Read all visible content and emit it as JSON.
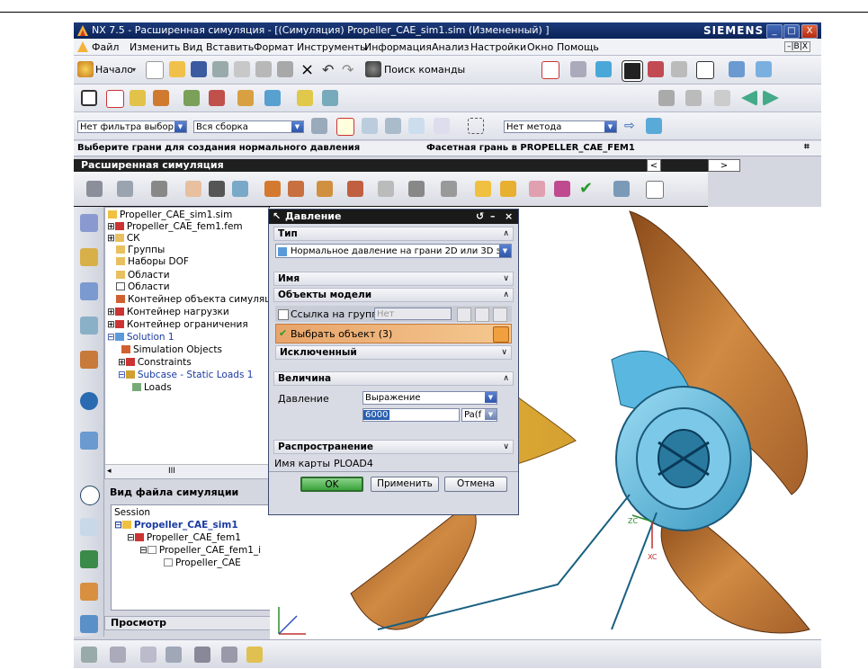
{
  "window": {
    "title": "NX 7.5 - Расширенная симуляция - [(Симуляция) Propeller_CAE_sim1.sim (Измененный) ]",
    "brand": "SIEMENS",
    "controls": [
      "_",
      "□",
      "X"
    ]
  },
  "menu": {
    "items": [
      "Файл",
      "Изменить",
      "Вид",
      "Вставить",
      "Формат",
      "Инструменты",
      "Информация",
      "Анализ",
      "Настройки",
      "Окно",
      "Помощь"
    ],
    "right": "–|B|X"
  },
  "toolbar1": {
    "start_label": "Начало",
    "find_command": "Поиск команды"
  },
  "selection_bar": {
    "filter": "Нет фильтра выбор",
    "scope": "Вся сборка",
    "method": "Нет метода"
  },
  "cue": {
    "left": "Выберите грани для создания нормального давления",
    "right": "Фасетная грань в PROPELLER_CAE_FEM1"
  },
  "adv_sim": {
    "title": "Расширенная симуляция",
    "nav_left": "<",
    "nav_right": ">"
  },
  "nav_tree": {
    "items": [
      {
        "label": "Propeller_CAE_sim1.sim",
        "prefix": ""
      },
      {
        "label": "Propeller_CAE_fem1.fem",
        "prefix": "⊞"
      },
      {
        "label": "СК",
        "prefix": "⊞"
      },
      {
        "label": "Группы",
        "prefix": ""
      },
      {
        "label": "Наборы DOF",
        "prefix": ""
      },
      {
        "label": "Области",
        "prefix": ""
      },
      {
        "label": "Области",
        "prefix": ""
      },
      {
        "label": "Контейнер объекта симуляции",
        "prefix": ""
      },
      {
        "label": "Контейнер нагрузки",
        "prefix": "⊞"
      },
      {
        "label": "Контейнер ограничения",
        "prefix": "⊞"
      },
      {
        "label": "Solution 1",
        "prefix": "⊟"
      },
      {
        "label": "Simulation Objects",
        "prefix": ""
      },
      {
        "label": "Constraints",
        "prefix": "⊞"
      },
      {
        "label": "Subcase - Static Loads 1",
        "prefix": "⊟"
      },
      {
        "label": "Loads",
        "prefix": ""
      }
    ],
    "scroll_label": "III"
  },
  "sim_file_view": {
    "title": "Вид файла симуляции",
    "items": [
      {
        "label": "Session",
        "prefix": ""
      },
      {
        "label": "Propeller_CAE_sim1",
        "prefix": "⊟"
      },
      {
        "label": "Propeller_CAE_fem1",
        "prefix": "⊟"
      },
      {
        "label": "Propeller_CAE_fem1_i",
        "prefix": "⊟"
      },
      {
        "label": "Propeller_CAE",
        "prefix": ""
      }
    ]
  },
  "preview": {
    "title": "Просмотр"
  },
  "dialog": {
    "title": "Давление",
    "controls": [
      "↺",
      "–",
      "×"
    ],
    "type_header": "Тип",
    "type_value": "Нормальное давление на грани 2D или 3D эл",
    "name_header": "Имя",
    "objects_header": "Объекты модели",
    "group_ref_label": "Ссылка на группу",
    "group_ref_value": "Нет",
    "select_object": "Выбрать объект (3)",
    "excluded_header": "Исключенный",
    "magnitude_header": "Величина",
    "pressure_label": "Давление",
    "pressure_mode": "Выражение",
    "pressure_value": "6000",
    "pressure_unit": "Pa(f",
    "distribution_header": "Распространение",
    "card_name_label": "Имя карты",
    "card_name_value": "PLOAD4",
    "ok": "OK",
    "apply": "Применить",
    "cancel": "Отмена"
  },
  "triad": {
    "xc": "XC",
    "zc": "ZC"
  },
  "colors": {
    "blade": "#c97b3a",
    "hub": "#5fb6d8",
    "title_bar": "#1c3a7a"
  }
}
